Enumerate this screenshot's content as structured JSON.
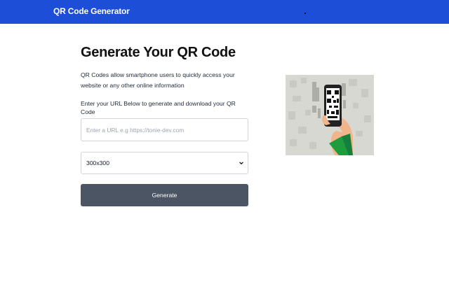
{
  "navbar": {
    "brand": "QR Code Generator",
    "color": "#1d4ed8"
  },
  "main": {
    "title": "Generate Your QR Code",
    "description": "QR Codes allow smartphone users to quickly access your website or any other online information",
    "instruction": "Enter your URL Below to generate and download your QR Code",
    "url_input": {
      "value": "",
      "placeholder": "Enter a URL e.g https://tonie-dev.com"
    },
    "size_select": {
      "selected": "300x300"
    },
    "generate_button": {
      "label": "Generate",
      "color": "#4b5563"
    }
  },
  "illustration": {
    "icon": "hand-holding-phone-scanning-qr-icon"
  }
}
